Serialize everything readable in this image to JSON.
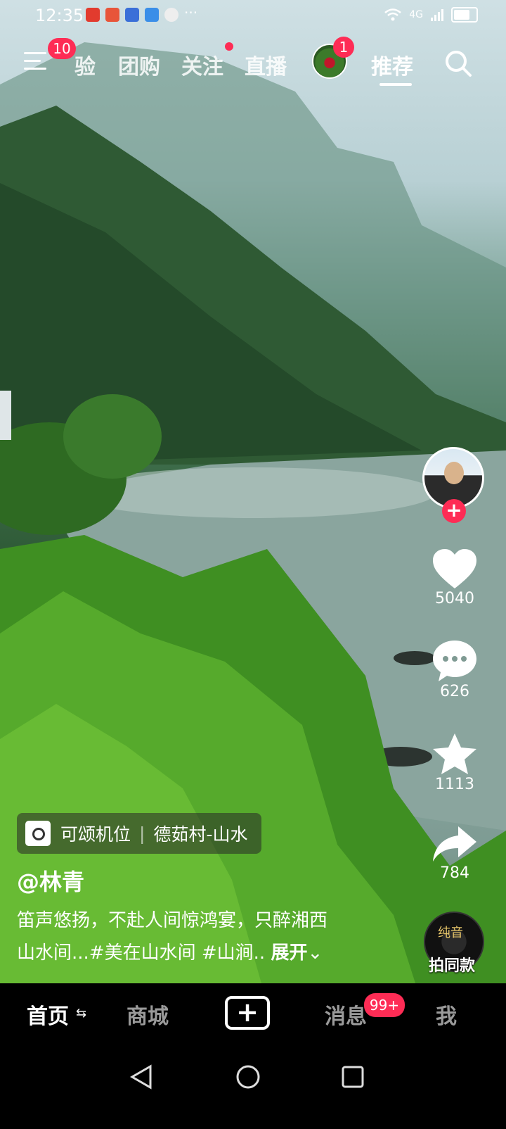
{
  "status_bar": {
    "time": "12:35",
    "dots": "···",
    "network": "4G"
  },
  "top_nav": {
    "menu_badge": "10",
    "tabs": [
      {
        "label": "验"
      },
      {
        "label": "团购"
      },
      {
        "label": "关注"
      },
      {
        "label": "直播"
      },
      {
        "label": "推荐"
      }
    ],
    "avatar_badge": "1"
  },
  "right_rail": {
    "follow_plus": "+",
    "likes": "5040",
    "comments": "626",
    "favorites": "1113",
    "shares": "784",
    "music_disc_text": "纯音",
    "same_style_label": "拍同款"
  },
  "post": {
    "location_primary": "可颂机位",
    "location_secondary": "德茹村-山水",
    "author": "@林青",
    "caption_line1": "笛声悠扬，不赴人间惊鸿宴，只醉湘西",
    "caption_line2": "山水间...#美在山水间 #山涧.. ",
    "expand_label": "展开"
  },
  "bottom_tabs": {
    "home": "首页",
    "mall": "商城",
    "plus": "+",
    "messages": "消息",
    "messages_badge": "99+",
    "me": "我"
  },
  "colors": {
    "accent": "#fe2c55",
    "tabbar_bg": "#000000"
  }
}
